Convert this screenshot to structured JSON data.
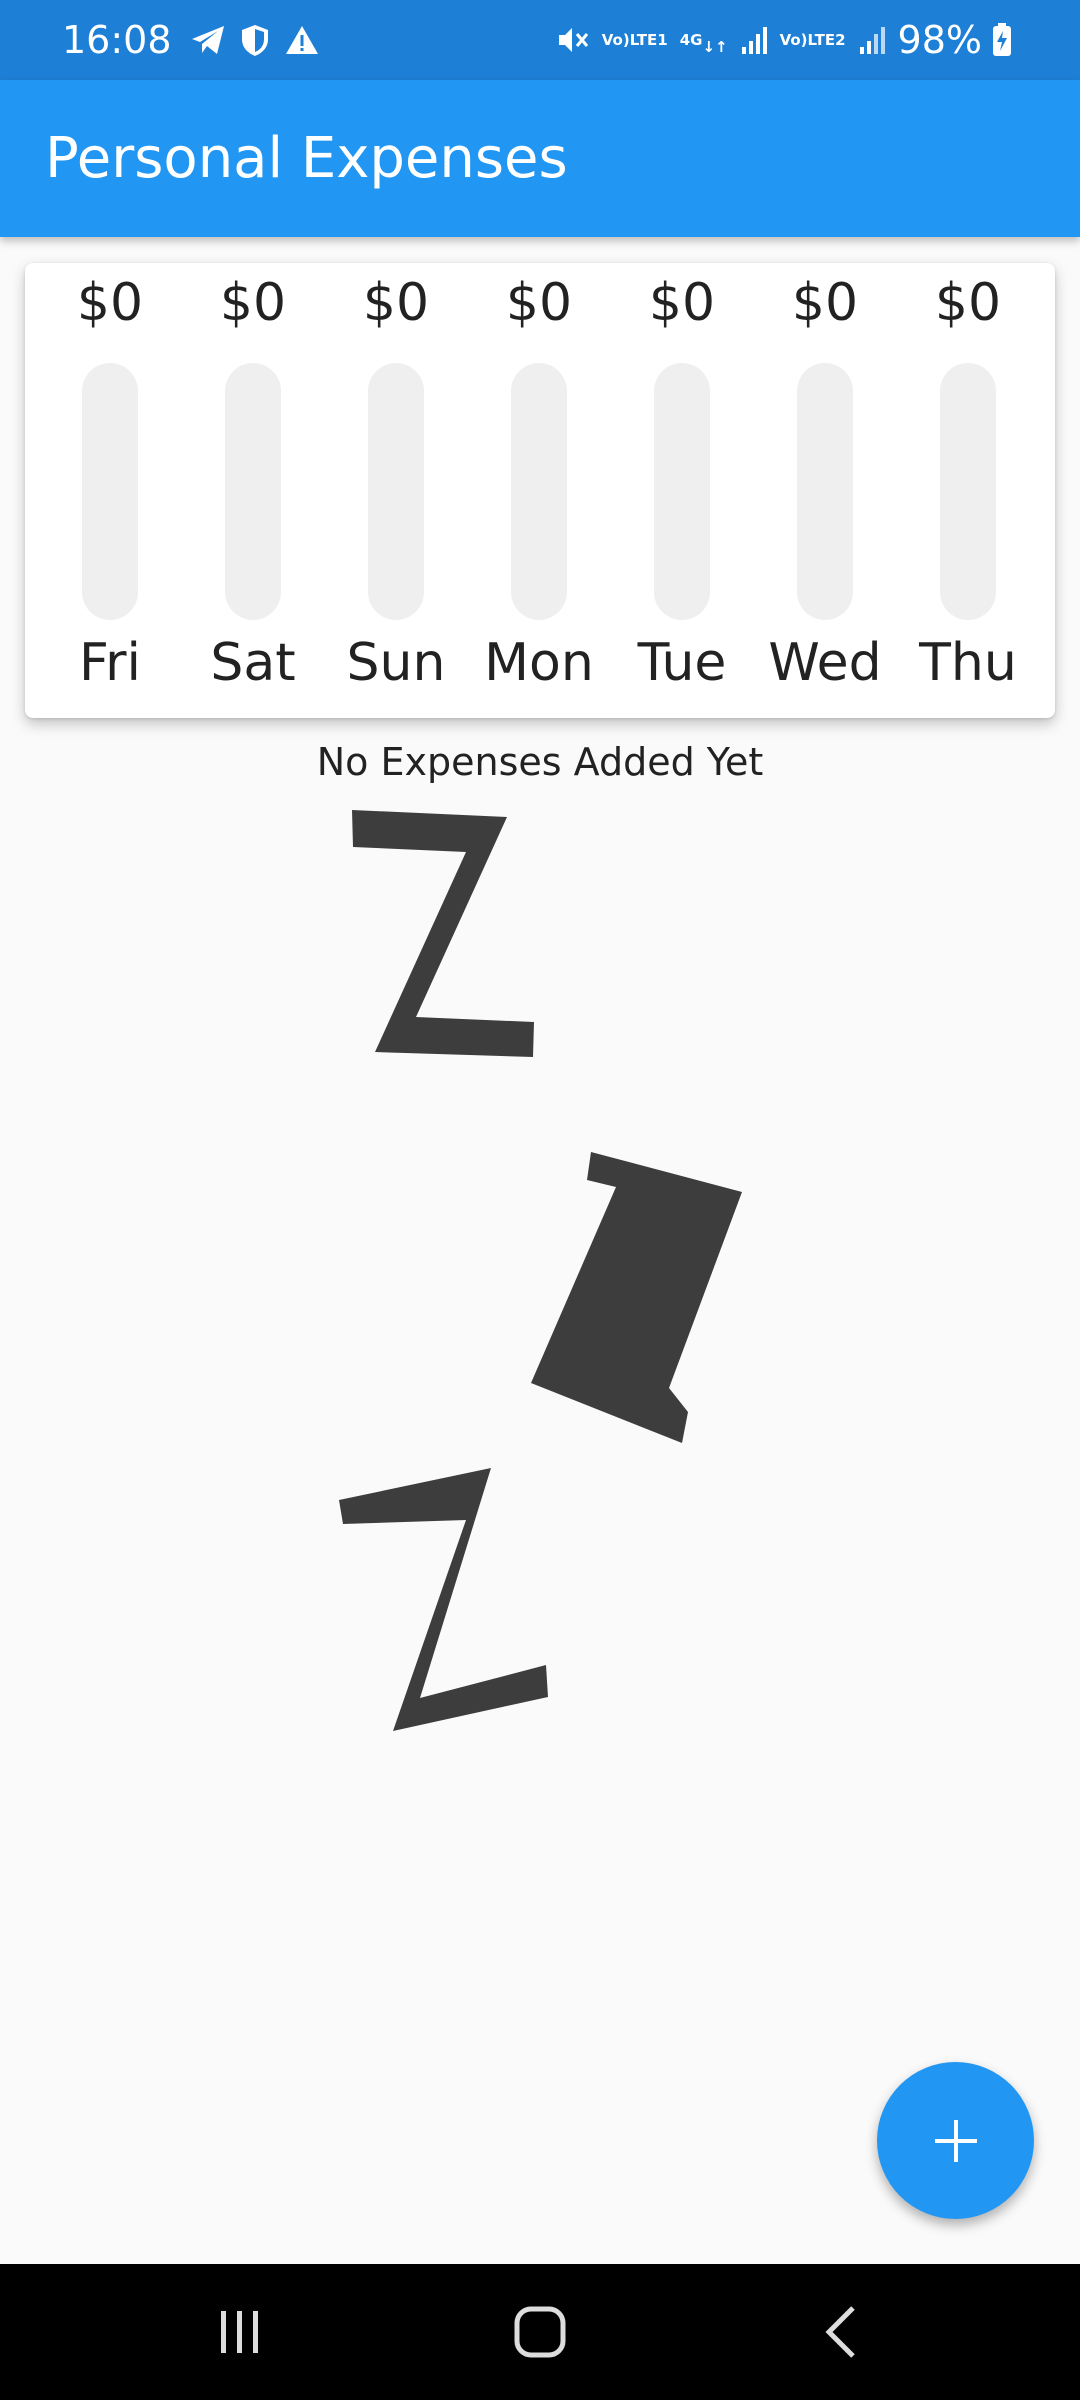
{
  "status_bar": {
    "time": "16:08",
    "volte1": "Vo)",
    "lte1": "LTE1",
    "net": "4G",
    "volte2": "Vo)",
    "lte2": "LTE2",
    "battery": "98%"
  },
  "app_bar": {
    "title": "Personal Expenses"
  },
  "chart": {
    "days": [
      {
        "amount": "$0",
        "label": "Fri",
        "fill": 0
      },
      {
        "amount": "$0",
        "label": "Sat",
        "fill": 0
      },
      {
        "amount": "$0",
        "label": "Sun",
        "fill": 0
      },
      {
        "amount": "$0",
        "label": "Mon",
        "fill": 0
      },
      {
        "amount": "$0",
        "label": "Tue",
        "fill": 0
      },
      {
        "amount": "$0",
        "label": "Wed",
        "fill": 0
      },
      {
        "amount": "$0",
        "label": "Thu",
        "fill": 0
      }
    ]
  },
  "empty_state": {
    "message": "No Expenses Added Yet",
    "illustration": "sleeping-zzz-icon"
  },
  "fab": {
    "icon": "plus-icon"
  },
  "colors": {
    "primary": "#2196f3",
    "status_bar": "#1e7fd6",
    "background": "#fafafa",
    "bar_empty": "#efefef",
    "zzz": "#3d3d3d"
  }
}
